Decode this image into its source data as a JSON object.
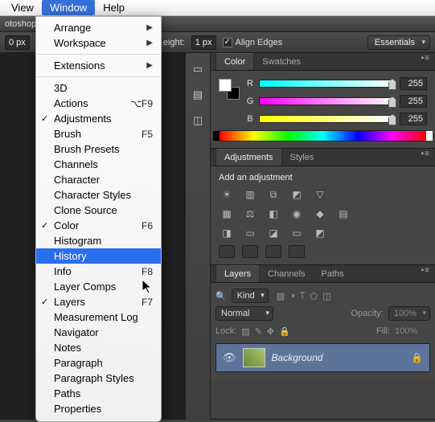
{
  "menubar": {
    "view": "View",
    "window": "Window",
    "help": "Help"
  },
  "appstrip": {
    "partial": "otoshop"
  },
  "optbar": {
    "px_value": "0 px",
    "height_label": "eight:",
    "height_value": "1 px",
    "align_label": "Align Edges",
    "workspace": "Essentials"
  },
  "color_panel": {
    "tab1": "Color",
    "tab2": "Swatches",
    "R": "R",
    "G": "G",
    "B": "B",
    "rv": "255",
    "gv": "255",
    "bv": "255"
  },
  "adjustments_panel": {
    "tab1": "Adjustments",
    "tab2": "Styles",
    "title": "Add an adjustment"
  },
  "layers_panel": {
    "tab1": "Layers",
    "tab2": "Channels",
    "tab3": "Paths",
    "kind": "Kind",
    "blend": "Normal",
    "opacity_label": "Opacity:",
    "opacity_value": "100%",
    "lock_label": "Lock:",
    "fill_label": "Fill:",
    "fill_value": "100%",
    "layer_name": "Background"
  },
  "vertbar_icons": {
    "a": "mb-histogram-icon",
    "b": "om-layers-icon",
    "c": "h-icon"
  },
  "dropdown": {
    "items": [
      {
        "label": "Arrange",
        "sub": true
      },
      {
        "label": "Workspace",
        "sub": true
      },
      {
        "sep": true
      },
      {
        "label": "Extensions",
        "sub": true
      },
      {
        "sep": true
      },
      {
        "label": "3D"
      },
      {
        "label": "Actions",
        "shortcut": "⌥F9"
      },
      {
        "label": "Adjustments",
        "checked": true
      },
      {
        "label": "Brush",
        "shortcut": "F5"
      },
      {
        "label": "Brush Presets"
      },
      {
        "label": "Channels"
      },
      {
        "label": "Character"
      },
      {
        "label": "Character Styles"
      },
      {
        "label": "Clone Source"
      },
      {
        "label": "Color",
        "checked": true,
        "shortcut": "F6"
      },
      {
        "label": "Histogram"
      },
      {
        "label": "History",
        "highlight": true
      },
      {
        "label": "Info",
        "shortcut": "F8"
      },
      {
        "label": "Layer Comps"
      },
      {
        "label": "Layers",
        "checked": true,
        "shortcut": "F7"
      },
      {
        "label": "Measurement Log"
      },
      {
        "label": "Navigator"
      },
      {
        "label": "Notes"
      },
      {
        "label": "Paragraph"
      },
      {
        "label": "Paragraph Styles"
      },
      {
        "label": "Paths"
      },
      {
        "label": "Properties"
      }
    ]
  }
}
